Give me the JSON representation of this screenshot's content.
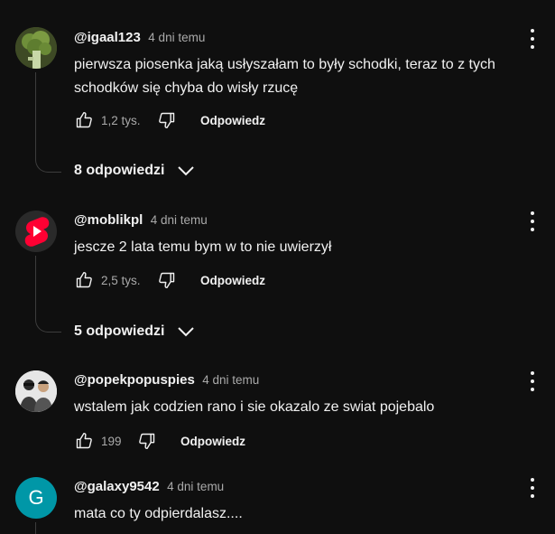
{
  "comments": [
    {
      "author": "@igaal123",
      "time": "4 dni temu",
      "text": "pierwsza piosenka jaką usłyszałam to były schodki, teraz to z tych schodków się chyba do wisły rzucę",
      "likes": "1,2 tys.",
      "reply_label": "Odpowiedz",
      "replies_label": "8 odpowiedzi",
      "avatar_icon": "broccoli-avatar"
    },
    {
      "author": "@moblikpl",
      "time": "4 dni temu",
      "text": "jescze 2 lata temu bym w to nie uwierzył",
      "likes": "2,5 tys.",
      "reply_label": "Odpowiedz",
      "replies_label": "5 odpowiedzi",
      "avatar_icon": "shorts-logo-avatar"
    },
    {
      "author": "@popekpopuspies",
      "time": "4 dni temu",
      "text": "wstalem jak codzien rano i sie okazalo ze swiat pojebalo",
      "likes": "199",
      "reply_label": "Odpowiedz",
      "avatar_icon": "photo-avatar"
    },
    {
      "author": "@galaxy9542",
      "time": "4 dni temu",
      "text": "mata co ty odpierdalasz....",
      "avatar_letter": "G",
      "avatar_color": "#0097a7"
    }
  ],
  "colors": {
    "background": "#0f0f0f",
    "text": "#f1f1f1",
    "muted": "#aaaaaa",
    "thread": "#3d3d3d"
  }
}
